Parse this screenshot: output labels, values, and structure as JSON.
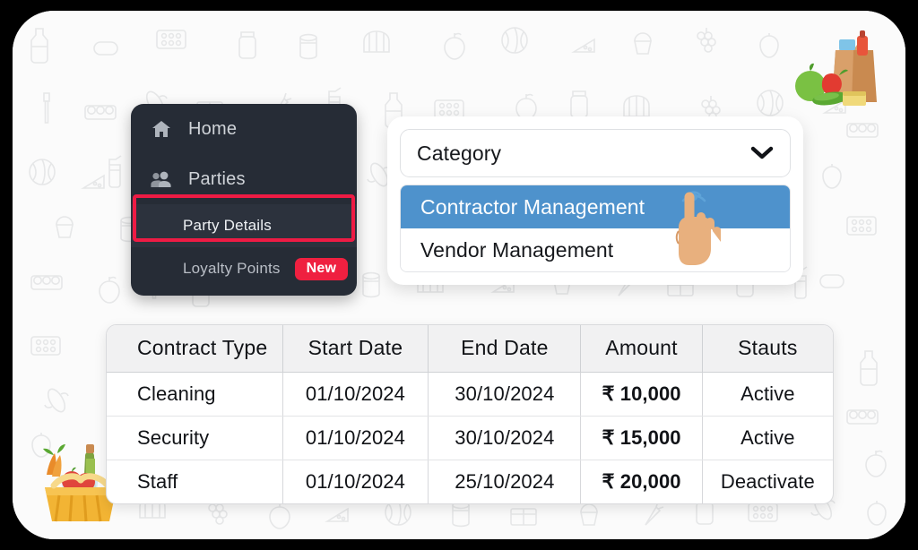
{
  "sidebar": {
    "items": [
      {
        "id": "home",
        "label": "Home",
        "icon": "home-icon"
      },
      {
        "id": "parties",
        "label": "Parties",
        "icon": "people-icon"
      },
      {
        "id": "party-details",
        "label": "Party Details",
        "icon": "none",
        "highlighted": true
      },
      {
        "id": "loyalty-points",
        "label": "Loyalty Points",
        "icon": "none",
        "badge": "New"
      }
    ],
    "badge_label": "New",
    "background_color": "#262c36",
    "highlight_color": "#ee1b44",
    "badge_color": "#ef2040"
  },
  "dropdown": {
    "field_label": "Category",
    "chevron_icon": "chevron-down-icon",
    "options": [
      {
        "label": "Contractor Management",
        "selected": true
      },
      {
        "label": "Vendor Management",
        "selected": false
      }
    ],
    "selected_color": "#4e92cc",
    "cursor_icon": "tap-hand-cursor-icon"
  },
  "table": {
    "columns": [
      "Contract Type",
      "Start Date",
      "End Date",
      "Amount",
      "Stauts"
    ],
    "rows": [
      {
        "contract_type": "Cleaning",
        "start_date": "01/10/2024",
        "end_date": "30/10/2024",
        "amount": "₹ 10,000",
        "status": "Active",
        "status_kind": "active"
      },
      {
        "contract_type": "Security",
        "start_date": "01/10/2024",
        "end_date": "30/10/2024",
        "amount": "₹ 15,000",
        "status": "Active",
        "status_kind": "active"
      },
      {
        "contract_type": "Staff",
        "start_date": "01/10/2024",
        "end_date": "25/10/2024",
        "amount": "₹ 20,000",
        "status": "Deactivate",
        "status_kind": "deactivate"
      }
    ],
    "amount_color": "#20a24a",
    "active_color": "#20a24a",
    "deactivate_color": "#e8425f"
  },
  "decoration": {
    "top_right_art": "grocery-bag-illustration",
    "bottom_left_art": "grocery-basket-illustration",
    "wallpaper": "grocery-doodle-pattern"
  }
}
